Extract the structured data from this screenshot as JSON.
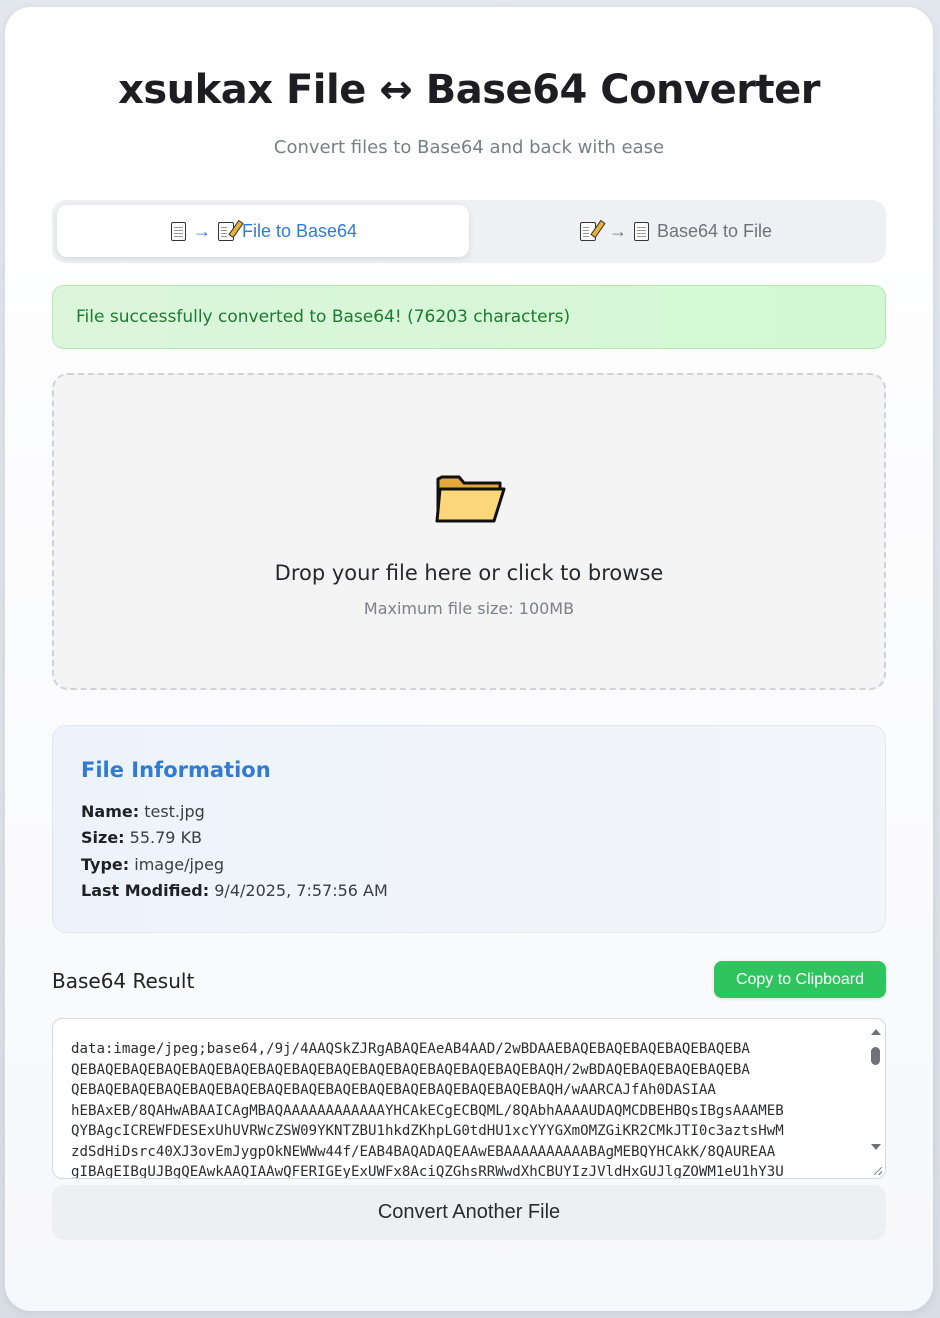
{
  "header": {
    "title": "xsukax File ↔ Base64 Converter",
    "subtitle": "Convert files to Base64 and back with ease"
  },
  "tabs": [
    {
      "label": "File to Base64",
      "arrow": "→",
      "icon_left": "document-icon",
      "icon_right": "memo-icon",
      "active": true
    },
    {
      "label": "Base64 to File",
      "arrow": "→",
      "icon_left": "memo-icon",
      "icon_right": "document-icon",
      "active": false
    }
  ],
  "status": {
    "message": "File successfully converted to Base64! (76203 characters)"
  },
  "dropzone": {
    "icon": "folder-icon",
    "title": "Drop your file here or click to browse",
    "subtitle": "Maximum file size: 100MB"
  },
  "file_info": {
    "title": "File Information",
    "name_label": "Name:",
    "name": "test.jpg",
    "size_label": "Size:",
    "size": "55.79 KB",
    "type_label": "Type:",
    "type": "image/jpeg",
    "modified_label": "Last Modified:",
    "modified": "9/4/2025, 7:57:56 AM"
  },
  "result": {
    "title": "Base64 Result",
    "copy_label": "Copy to Clipboard",
    "lines": [
      "data:image/jpeg;base64,/9j/4AAQSkZJRgABAQEAeAB4AAD/2wBDAAEBAQEBAQEBAQEBAQEBAQEBA",
      "QEBAQEBAQEBAQEBAQEBAQEBAQEBAQEBAQEBAQEBAQEBAQEBAQEBAQEBAQH/2wBDAQEBAQEBAQEBAQEBA",
      "QEBAQEBAQEBAQEBAQEBAQEBAQEBAQEBAQEBAQEBAQEBAQEBAQEBAQEBAQH/wAARCAJfAh0DASIAA",
      "hEBAxEB/8QAHwABAAICAgMBAQAAAAAAAAAAAAYHCAkECgECBQML/8QAbhAAAAUDAQMCDBEHBQsIBgsAAAMEB",
      "QYBAgcICREWFDESExUhUVRWcZSW09YKNTZBU1hkdZKhpLG0tdHU1xcYYYGXmOMZGiKR2CMkJTI0c3aztsHwM",
      "zdSdHiDsrc40XJ3ovEmJygpOkNEWWw44f/EAB4BAQADAQEAAwEBAAAAAAAAAABAgMEBQYHCAkK/8QAUREAA",
      "gIBAgEIBgUJBgQEAwkAAQIAAwQFERIGEyExUWFx8AciQZGhsRRWwdXhCBUYIzJVldHxGUJlgZOWM1eU1hY3U"
    ],
    "convert_again_label": "Convert Another File"
  }
}
